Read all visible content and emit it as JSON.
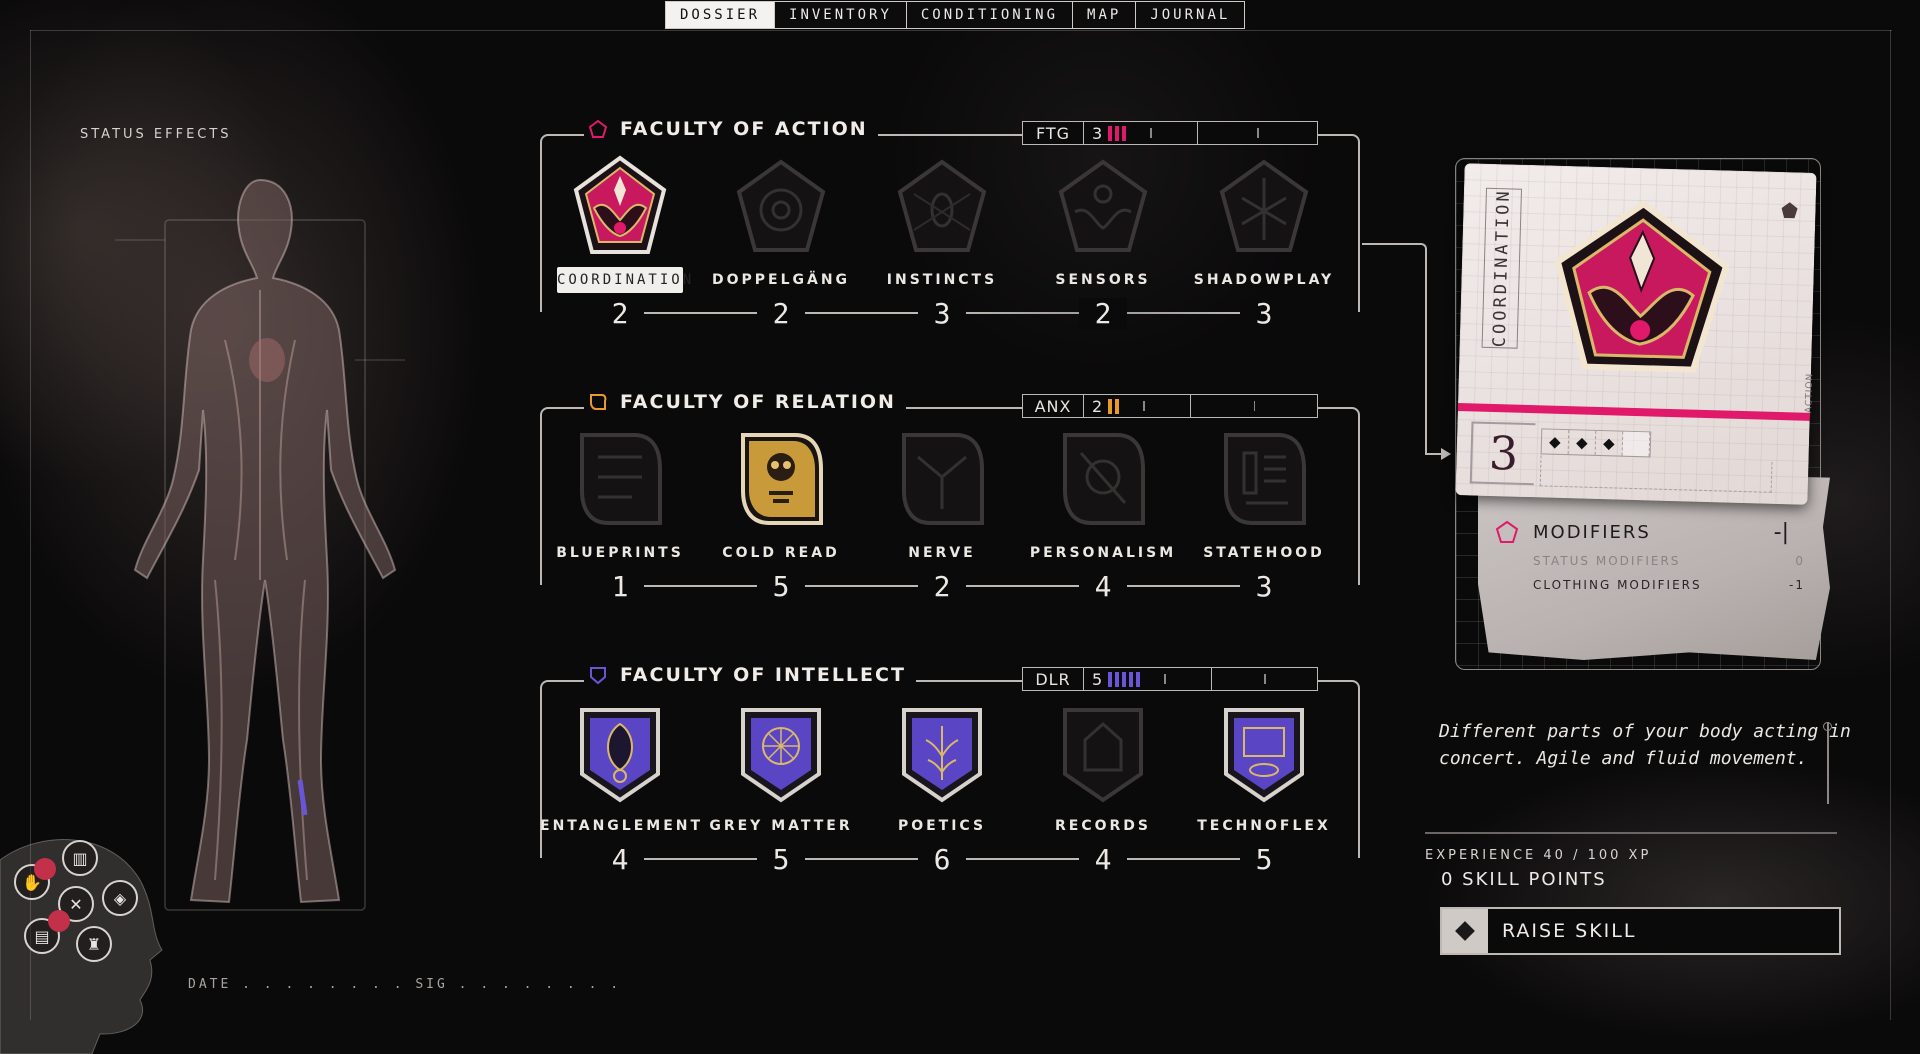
{
  "nav": {
    "tabs": [
      {
        "label": "DOSSIER",
        "active": true
      },
      {
        "label": "INVENTORY",
        "active": false
      },
      {
        "label": "CONDITIONING",
        "active": false
      },
      {
        "label": "MAP",
        "active": false
      },
      {
        "label": "JOURNAL",
        "active": false
      }
    ]
  },
  "left": {
    "status_title": "STATUS EFFECTS",
    "date_sig": "DATE . . . . . . . . SIG . . . . . . . ."
  },
  "colors": {
    "action": "#e0196a",
    "relation": "#e89a2a",
    "intellect": "#6a55d6",
    "accent_pink": "#e0196a"
  },
  "faculties": [
    {
      "title": "FACULTY OF ACTION",
      "icon": "pentagon-icon",
      "stat": {
        "abbr": "FTG",
        "value": "3",
        "bars": 3,
        "color": "#e0196a"
      },
      "skills": [
        {
          "label": "COORDINATION",
          "value": "2",
          "selected": true,
          "unlocked": true
        },
        {
          "label": "DOPPELGÄNG",
          "value": "2",
          "selected": false,
          "unlocked": false
        },
        {
          "label": "INSTINCTS",
          "value": "3",
          "selected": false,
          "unlocked": false
        },
        {
          "label": "SENSORS",
          "value": "2",
          "selected": false,
          "unlocked": false
        },
        {
          "label": "SHADOWPLAY",
          "value": "3",
          "selected": false,
          "unlocked": false
        }
      ]
    },
    {
      "title": "FACULTY OF RELATION",
      "icon": "leaf-icon",
      "stat": {
        "abbr": "ANX",
        "value": "2",
        "bars": 2,
        "color": "#e89a2a"
      },
      "skills": [
        {
          "label": "BLUEPRINTS",
          "value": "1",
          "selected": false,
          "unlocked": false
        },
        {
          "label": "COLD READ",
          "value": "5",
          "selected": false,
          "unlocked": true
        },
        {
          "label": "NERVE",
          "value": "2",
          "selected": false,
          "unlocked": false
        },
        {
          "label": "PERSONALISM",
          "value": "4",
          "selected": false,
          "unlocked": false
        },
        {
          "label": "STATEHOOD",
          "value": "3",
          "selected": false,
          "unlocked": false
        }
      ]
    },
    {
      "title": "FACULTY OF INTELLECT",
      "icon": "shield-icon",
      "stat": {
        "abbr": "DLR",
        "value": "5",
        "bars": 5,
        "color": "#6a55d6"
      },
      "skills": [
        {
          "label": "ENTANGLEMENT",
          "value": "4",
          "selected": false,
          "unlocked": true
        },
        {
          "label": "GREY MATTER",
          "value": "5",
          "selected": false,
          "unlocked": true
        },
        {
          "label": "POETICS",
          "value": "6",
          "selected": false,
          "unlocked": true
        },
        {
          "label": "RECORDS",
          "value": "4",
          "selected": false,
          "unlocked": false
        },
        {
          "label": "TECHNOFLEX",
          "value": "5",
          "selected": false,
          "unlocked": true
        }
      ]
    }
  ],
  "card": {
    "title": "COORDINATION",
    "side_label": "ACTION",
    "level": "3",
    "pips_filled": 3,
    "pips_total": 4,
    "modifiers_title": "MODIFIERS",
    "modifiers_value": "-|",
    "rows": [
      {
        "label": "STATUS MODIFIERS",
        "value": "0",
        "dim": true
      },
      {
        "label": "CLOTHING MODIFIERS",
        "value": "-1",
        "dim": false
      }
    ]
  },
  "description": "Different parts of your body acting in concert. Agile and fluid movement.",
  "experience": "EXPERIENCE 40 / 100 XP",
  "skill_points": "0 SKILL POINTS",
  "raise_button": "RAISE SKILL"
}
